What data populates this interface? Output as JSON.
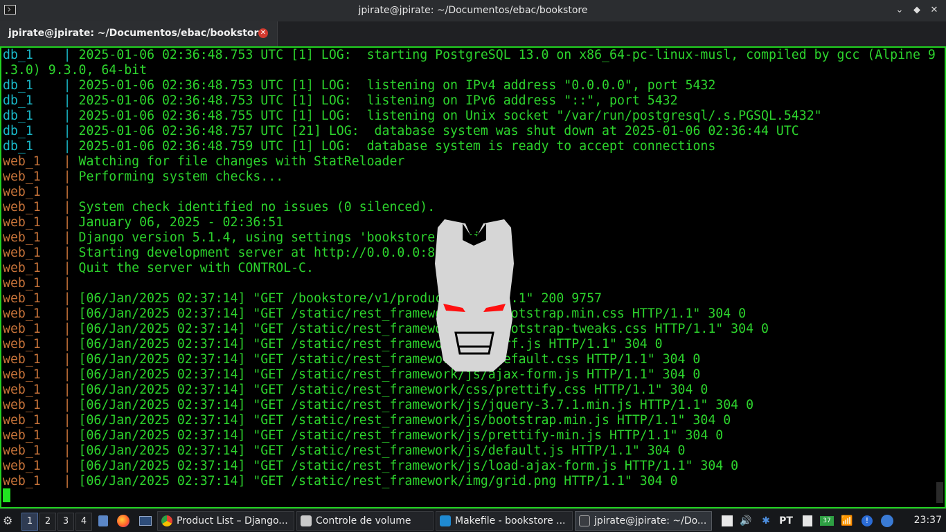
{
  "window": {
    "title": "jpirate@jpirate: ~/Documentos/ebac/bookstore",
    "controls": [
      "chevron-down-icon",
      "diamond-icon",
      "close-icon"
    ]
  },
  "tab": {
    "label": "jpirate@jpirate: ~/Documentos/ebac/bookstore",
    "close_symbol": "✕"
  },
  "terminal": {
    "lines": [
      {
        "svc": "db_1",
        "msg": "2025-01-06 02:36:48.753 UTC [1] LOG:  starting PostgreSQL 13.0 on x86_64-pc-linux-musl, compiled by gcc (Alpine 9"
      },
      {
        "svc": "",
        "msg": ".3.0) 9.3.0, 64-bit"
      },
      {
        "svc": "db_1",
        "msg": "2025-01-06 02:36:48.753 UTC [1] LOG:  listening on IPv4 address \"0.0.0.0\", port 5432"
      },
      {
        "svc": "db_1",
        "msg": "2025-01-06 02:36:48.753 UTC [1] LOG:  listening on IPv6 address \"::\", port 5432"
      },
      {
        "svc": "db_1",
        "msg": "2025-01-06 02:36:48.755 UTC [1] LOG:  listening on Unix socket \"/var/run/postgresql/.s.PGSQL.5432\""
      },
      {
        "svc": "db_1",
        "msg": "2025-01-06 02:36:48.757 UTC [21] LOG:  database system was shut down at 2025-01-06 02:36:44 UTC"
      },
      {
        "svc": "db_1",
        "msg": "2025-01-06 02:36:48.759 UTC [1] LOG:  database system is ready to accept connections"
      },
      {
        "svc": "web_1",
        "msg": "Watching for file changes with StatReloader"
      },
      {
        "svc": "web_1",
        "msg": "Performing system checks..."
      },
      {
        "svc": "web_1",
        "msg": ""
      },
      {
        "svc": "web_1",
        "msg": "System check identified no issues (0 silenced)."
      },
      {
        "svc": "web_1",
        "msg": "January 06, 2025 - 02:36:51"
      },
      {
        "svc": "web_1",
        "msg": "Django version 5.1.4, using settings 'bookstore.settings'"
      },
      {
        "svc": "web_1",
        "msg": "Starting development server at http://0.0.0.0:8000/"
      },
      {
        "svc": "web_1",
        "msg": "Quit the server with CONTROL-C."
      },
      {
        "svc": "web_1",
        "msg": ""
      },
      {
        "svc": "web_1",
        "msg": "[06/Jan/2025 02:37:14] \"GET /bookstore/v1/product/ HTTP/1.1\" 200 9757"
      },
      {
        "svc": "web_1",
        "msg": "[06/Jan/2025 02:37:14] \"GET /static/rest_framework/css/bootstrap.min.css HTTP/1.1\" 304 0"
      },
      {
        "svc": "web_1",
        "msg": "[06/Jan/2025 02:37:14] \"GET /static/rest_framework/css/bootstrap-tweaks.css HTTP/1.1\" 304 0"
      },
      {
        "svc": "web_1",
        "msg": "[06/Jan/2025 02:37:14] \"GET /static/rest_framework/js/csrf.js HTTP/1.1\" 304 0"
      },
      {
        "svc": "web_1",
        "msg": "[06/Jan/2025 02:37:14] \"GET /static/rest_framework/css/default.css HTTP/1.1\" 304 0"
      },
      {
        "svc": "web_1",
        "msg": "[06/Jan/2025 02:37:14] \"GET /static/rest_framework/js/ajax-form.js HTTP/1.1\" 304 0"
      },
      {
        "svc": "web_1",
        "msg": "[06/Jan/2025 02:37:14] \"GET /static/rest_framework/css/prettify.css HTTP/1.1\" 304 0"
      },
      {
        "svc": "web_1",
        "msg": "[06/Jan/2025 02:37:14] \"GET /static/rest_framework/js/jquery-3.7.1.min.js HTTP/1.1\" 304 0"
      },
      {
        "svc": "web_1",
        "msg": "[06/Jan/2025 02:37:14] \"GET /static/rest_framework/js/bootstrap.min.js HTTP/1.1\" 304 0"
      },
      {
        "svc": "web_1",
        "msg": "[06/Jan/2025 02:37:14] \"GET /static/rest_framework/js/prettify-min.js HTTP/1.1\" 304 0"
      },
      {
        "svc": "web_1",
        "msg": "[06/Jan/2025 02:37:14] \"GET /static/rest_framework/js/default.js HTTP/1.1\" 304 0"
      },
      {
        "svc": "web_1",
        "msg": "[06/Jan/2025 02:37:14] \"GET /static/rest_framework/js/load-ajax-form.js HTTP/1.1\" 304 0"
      },
      {
        "svc": "web_1",
        "msg": "[06/Jan/2025 02:37:14] \"GET /static/rest_framework/img/grid.png HTTP/1.1\" 304 0"
      }
    ],
    "colors": {
      "db": "#19b7c7",
      "web": "#c8743a",
      "message": "#2dd42d",
      "border": "#21d321"
    }
  },
  "taskbar": {
    "workspaces": [
      "1",
      "2",
      "3",
      "4"
    ],
    "active_workspace": "1",
    "launchers": [
      "file-manager-icon",
      "firefox-icon",
      "terminal-icon"
    ],
    "tasks": [
      {
        "label": "Product List – Django...",
        "icon": "chrome-icon"
      },
      {
        "label": "Controle de volume",
        "icon": "volume-control-icon"
      },
      {
        "label": "Makefile - bookstore ...",
        "icon": "vscode-icon"
      },
      {
        "label": "jpirate@jpirate: ~/Do...",
        "icon": "terminal-icon"
      }
    ],
    "tray": {
      "keyboard_layout": "PT",
      "badge": "37",
      "icons": [
        "notes-icon",
        "speaker-icon",
        "bluetooth-icon",
        "clipboard-icon",
        "battery-icon",
        "network-icon",
        "notification-icon",
        "update-icon"
      ]
    },
    "clock": "23:37"
  }
}
